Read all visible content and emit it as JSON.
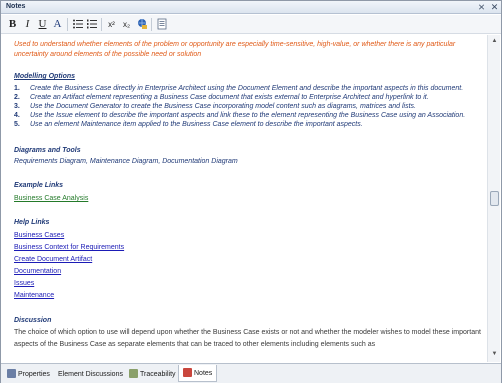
{
  "window": {
    "title": "Notes",
    "pin_icon": "pin-icon",
    "close_icon": "close-icon"
  },
  "toolbar": {
    "bold": "B",
    "italic": "I",
    "underline": "U",
    "font_color": "A",
    "superscript": "x²",
    "subscript": "x₂"
  },
  "content": {
    "intro": "Used to understand whether elements of the problem or opportunity are especially time-sensitive, high-value, or whether there is any particular uncertainty around elements of the possible need or solution",
    "modelling_heading": "Modelling Options",
    "options": [
      {
        "num": "1.",
        "text": "Create the Business Case directly in Enterprise Architect using the Document Element and describe the important aspects in this document."
      },
      {
        "num": "2.",
        "text": "Create an Artifact element representing a Business Case document that exists external to Enterprise Architect and hyperlink to it."
      },
      {
        "num": "3.",
        "text": "Use the Document Generator to create the Business Case incorporating model content such as diagrams, matrices and lists."
      },
      {
        "num": "4.",
        "text": "Use the Issue element to describe the important aspects and link these to the element representing the Business Case using an Association."
      },
      {
        "num": "5.",
        "text": "Use an element Maintenance item applied to the Business Case element to describe the important aspects."
      }
    ],
    "diagrams_heading": "Diagrams and Tools",
    "diagrams_text": "Requirements Diagram, Maintenance Diagram, Documentation Diagram",
    "example_heading": "Example Links",
    "example_links": [
      "Business Case Analysis"
    ],
    "help_heading": "Help Links",
    "help_links": [
      "Business Cases",
      "Business Context for Requirements",
      "Create Document Artifact",
      "Documentation",
      "Issues",
      "Maintenance"
    ],
    "discussion_heading": "Discussion",
    "discussion_text": "The choice of which option to use will depend upon whether the Business Case exists or not  and whether the modeler wishes to model these important aspects of the Business Case as separate elements that can be traced to other elements including elements such as"
  },
  "tabs": [
    {
      "label": "Properties",
      "icon": "properties-icon",
      "active": false
    },
    {
      "label": "Element Discussions",
      "icon": "",
      "active": false
    },
    {
      "label": "Traceability",
      "icon": "traceability-icon",
      "active": false
    },
    {
      "label": "Notes",
      "icon": "notes-icon",
      "active": true
    }
  ],
  "colors": {
    "intro": "#e05a17",
    "heading": "#203a77",
    "link": "#1b1bb6",
    "example_link": "#247a2a"
  }
}
